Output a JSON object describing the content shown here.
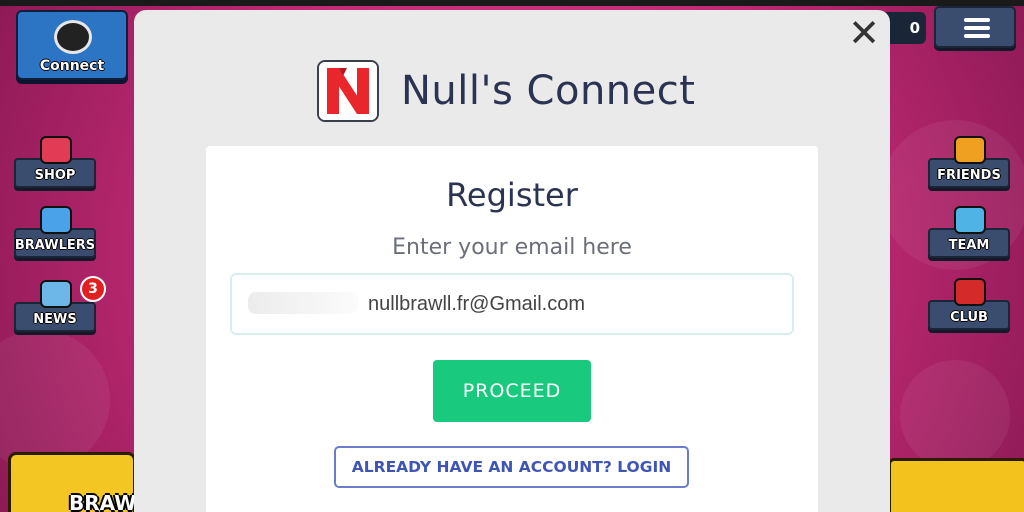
{
  "game": {
    "connect_label": "Connect",
    "left_buttons": [
      {
        "id": "shop",
        "label": "SHOP",
        "icon": "shop-icon",
        "color": "#e23b55"
      },
      {
        "id": "brawlers",
        "label": "BRAWLERS",
        "icon": "brawlers-icon",
        "color": "#4aa3e8"
      },
      {
        "id": "news",
        "label": "NEWS",
        "icon": "news-icon",
        "color": "#6db6e8"
      }
    ],
    "news_badge": "3",
    "right_buttons": [
      {
        "id": "friends",
        "label": "FRIENDS",
        "icon": "friends-icon",
        "color": "#f0a020"
      },
      {
        "id": "team",
        "label": "TEAM",
        "icon": "team-icon",
        "color": "#4fb3e6"
      },
      {
        "id": "club",
        "label": "CLUB",
        "icon": "club-icon",
        "color": "#d52a2a"
      }
    ],
    "currency_value": "0",
    "brawl_label": "BRAWL",
    "menu_icon": "hamburger-icon"
  },
  "modal": {
    "title": "Null's Connect",
    "logo_letter": "N",
    "close_icon": "close-icon",
    "register_title": "Register",
    "register_subtitle": "Enter your email here",
    "email_value": "nullbrawll.fr@Gmail.com",
    "proceed_label": "PROCEED",
    "login_label": "ALREADY HAVE AN ACCOUNT? LOGIN"
  },
  "colors": {
    "accent_green": "#19c97e",
    "accent_blue": "#3f55b5",
    "title_navy": "#2b3352",
    "background_pink": "#c22a74",
    "logo_red": "#e8262b"
  }
}
